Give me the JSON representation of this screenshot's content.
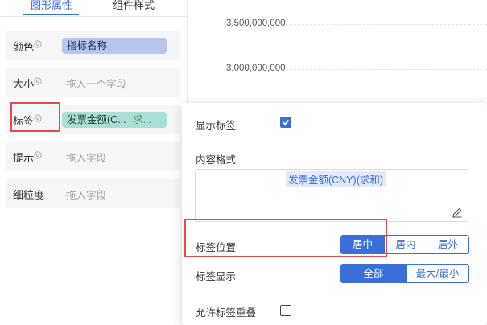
{
  "tabs": [
    {
      "label": "图形属性",
      "active": true
    },
    {
      "label": "组件样式",
      "active": false
    }
  ],
  "properties": [
    {
      "label": "颜色",
      "value": "指标名称",
      "type": "chip-blue"
    },
    {
      "label": "大小",
      "placeholder": "拖入一个字段",
      "type": "placeholder"
    },
    {
      "label": "标签",
      "value": "发票金额(C...",
      "agg": "求...",
      "type": "chip-teal",
      "highlighted": true
    },
    {
      "label": "提示",
      "placeholder": "拖入字段",
      "type": "placeholder"
    },
    {
      "label": "细粒度",
      "placeholder": "拖入字段",
      "type": "placeholder"
    }
  ],
  "chart": {
    "y_ticks": [
      "3,500,000,000",
      "3,000,000,000"
    ]
  },
  "popover": {
    "show_label": {
      "label": "显示标签",
      "checked": true
    },
    "content_format": {
      "label": "内容格式",
      "tag": "发票金额(CNY)(求和)"
    },
    "label_position": {
      "label": "标签位置",
      "options": [
        "居中",
        "居内",
        "居外"
      ],
      "selected": "居中"
    },
    "label_display": {
      "label": "标签显示",
      "options": [
        "全部",
        "最大/最小"
      ],
      "selected": "全部"
    },
    "allow_overlap": {
      "label": "允许标签重叠",
      "checked": false
    }
  },
  "colors": {
    "accent": "#3b6fd8",
    "highlight": "#e24b4b",
    "chip_blue": "#b7c6ee",
    "chip_teal": "#a9dfd5"
  }
}
